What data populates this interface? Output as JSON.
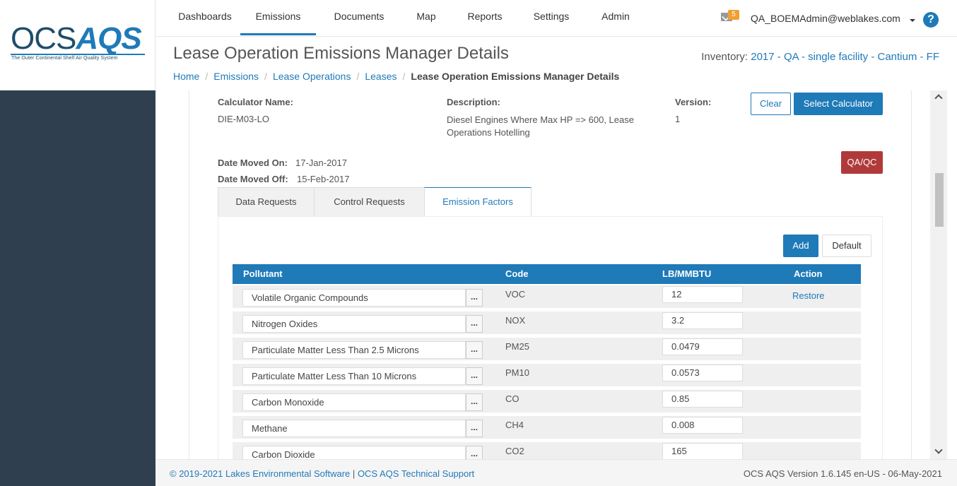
{
  "logo": {
    "ocs": "OCS",
    "aqs": "AQS",
    "subtitle": "The Outer Continental Shelf Air Quality System"
  },
  "nav": {
    "items": [
      "Dashboards",
      "Emissions",
      "Documents",
      "Map",
      "Reports",
      "Settings",
      "Admin"
    ],
    "active": "Emissions"
  },
  "user": {
    "mail_count": "5",
    "email": "QA_BOEMAdmin@weblakes.com",
    "help": "?"
  },
  "page": {
    "title": "Lease Operation Emissions Manager Details",
    "inventory_label": "Inventory:",
    "inventory_value": "2017 - QA - single facility - Cantium - FF"
  },
  "breadcrumb": [
    "Home",
    "Emissions",
    "Lease Operations",
    "Leases",
    "Lease Operation Emissions Manager Details"
  ],
  "calculator": {
    "name_label": "Calculator Name:",
    "name_value": "DIE-M03-LO",
    "desc_label": "Description:",
    "desc_value": "Diesel Engines Where Max HP => 600, Lease Operations Hotelling",
    "version_label": "Version:",
    "version_value": "1",
    "clear_btn": "Clear",
    "select_btn": "Select Calculator",
    "moved_on_label": "Date Moved On:",
    "moved_on_value": "17-Jan-2017",
    "moved_off_label": "Date Moved Off:",
    "moved_off_value": "15-Feb-2017",
    "qaqc_btn": "QA/QC"
  },
  "tabs": [
    "Data Requests",
    "Control Requests",
    "Emission Factors"
  ],
  "active_tab": "Emission Factors",
  "factors": {
    "add_btn": "Add",
    "default_btn": "Default",
    "columns": [
      "Pollutant",
      "Code",
      "LB/MMBTU",
      "Action"
    ],
    "rows": [
      {
        "pollutant": "Volatile Organic Compounds",
        "code": "VOC",
        "value": "12",
        "action": "Restore"
      },
      {
        "pollutant": "Nitrogen Oxides",
        "code": "NOX",
        "value": "3.2",
        "action": ""
      },
      {
        "pollutant": "Particulate Matter Less Than 2.5 Microns",
        "code": "PM25",
        "value": "0.0479",
        "action": ""
      },
      {
        "pollutant": "Particulate Matter Less Than 10 Microns",
        "code": "PM10",
        "value": "0.0573",
        "action": ""
      },
      {
        "pollutant": "Carbon Monoxide",
        "code": "CO",
        "value": "0.85",
        "action": ""
      },
      {
        "pollutant": "Methane",
        "code": "CH4",
        "value": "0.008",
        "action": ""
      },
      {
        "pollutant": "Carbon Dioxide",
        "code": "CO2",
        "value": "165",
        "action": ""
      }
    ],
    "dots": "..."
  },
  "footer": {
    "copyright": "© 2019-2021 Lakes Environmental Software",
    "separator": "|",
    "support": "OCS AQS Technical Support",
    "version": "OCS AQS Version 1.6.145 en-US - 06-May-2021"
  }
}
